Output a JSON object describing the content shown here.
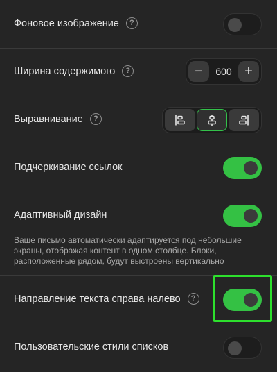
{
  "rows": {
    "background_image": {
      "label": "Фоновое изображение",
      "toggle": "off"
    },
    "content_width": {
      "label": "Ширина содержимого",
      "value": "600",
      "minus": "−",
      "plus": "+"
    },
    "alignment": {
      "label": "Выравнивание",
      "options": [
        "left",
        "center",
        "right"
      ],
      "selected": "center"
    },
    "link_underline": {
      "label": "Подчеркивание ссылок",
      "toggle": "on"
    },
    "responsive": {
      "label": "Адаптивный дизайн",
      "toggle": "on",
      "description": "Ваше письмо автоматически адаптируется под небольшие экраны, отображая контент в одном столбце. Блоки, расположенные рядом, будут выстроены вертикально"
    },
    "rtl": {
      "label": "Направление текста справа налево",
      "toggle": "on"
    },
    "custom_list_styles": {
      "label": "Пользовательские стили списков",
      "toggle": "off"
    }
  },
  "help_glyph": "?",
  "colors": {
    "background": "#252525",
    "toggle_on": "#34c144",
    "highlight": "#2de02d"
  },
  "icons": {
    "help": "question-circle-icon",
    "align_left": "align-left-icon",
    "align_center": "align-center-icon",
    "align_right": "align-right-icon"
  }
}
